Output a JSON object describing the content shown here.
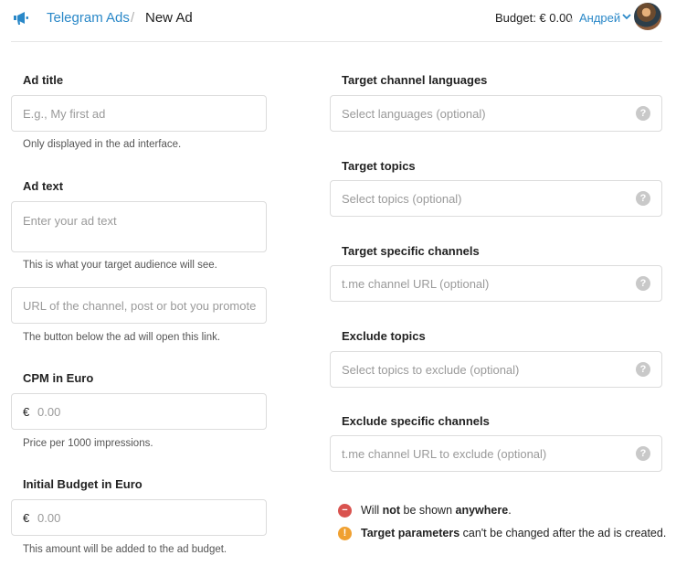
{
  "header": {
    "brand": "Telegram Ads",
    "separator": "/",
    "page_title": "New Ad",
    "budget": "Budget: € 0.00",
    "user_name": "Андрей"
  },
  "left": {
    "ad_title": {
      "label": "Ad title",
      "placeholder": "E.g., My first ad",
      "hint": "Only displayed in the ad interface."
    },
    "ad_text": {
      "label": "Ad text",
      "placeholder": "Enter your ad text",
      "hint": "This is what your target audience will see."
    },
    "url": {
      "placeholder": "URL of the channel, post or bot you promote",
      "hint": "The button below the ad will open this link."
    },
    "cpm": {
      "label": "CPM in Euro",
      "currency": "€",
      "placeholder": "0.00",
      "hint": "Price per 1000 impressions."
    },
    "budget": {
      "label": "Initial Budget in Euro",
      "currency": "€",
      "placeholder": "0.00",
      "hint": "This amount will be added to the ad budget."
    }
  },
  "right": {
    "languages": {
      "label": "Target channel languages",
      "placeholder": "Select languages (optional)"
    },
    "topics": {
      "label": "Target topics",
      "placeholder": "Select topics (optional)"
    },
    "channels": {
      "label": "Target specific channels",
      "placeholder": "t.me channel URL (optional)"
    },
    "exclude_topics": {
      "label": "Exclude topics",
      "placeholder": "Select topics to exclude (optional)"
    },
    "exclude_channels": {
      "label": "Exclude specific channels",
      "placeholder": "t.me channel URL to exclude (optional)"
    },
    "help_glyph": "?"
  },
  "notes": {
    "not_shown": {
      "pre": "Will ",
      "b1": "not",
      "mid": " be shown ",
      "b2": "anywhere",
      "post": "."
    },
    "target_params": {
      "b1": "Target parameters",
      "post": " can't be changed after the ad is created."
    },
    "minus_glyph": "−",
    "excl_glyph": "!"
  },
  "colors": {
    "accent": "#2a88c8",
    "error": "#d9534f",
    "warning": "#f0a030"
  }
}
